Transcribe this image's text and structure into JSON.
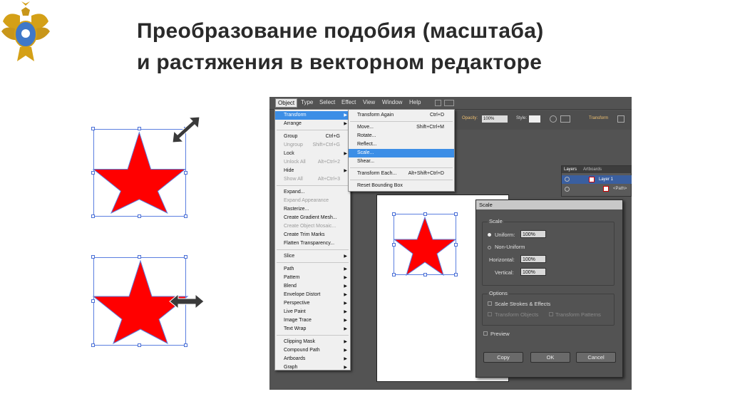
{
  "title_lines": [
    "Преобразование подобия (масштаба)",
    "и растяжения в векторном редакторе"
  ],
  "colors": {
    "star": "#ff0000",
    "selection": "#5b7fe0",
    "highlight": "#3c8ee6",
    "panel": "#535353"
  },
  "icons": [
    "emblem-icon",
    "diagonal-resize-arrow-icon",
    "horizontal-resize-arrow-icon",
    "star-shape-icon"
  ],
  "menubar": [
    "Object",
    "Type",
    "Select",
    "Effect",
    "View",
    "Window",
    "Help"
  ],
  "ctrlbar": {
    "opacity_label": "Opacity:",
    "opacity_value": "100%",
    "style_label": "Style:",
    "transform_label": "Transform"
  },
  "object_menu": [
    {
      "label": "Transform",
      "submenu": true,
      "highlighted": true
    },
    {
      "label": "Arrange",
      "submenu": true
    },
    {
      "sep": true
    },
    {
      "label": "Group",
      "shortcut": "Ctrl+G"
    },
    {
      "label": "Ungroup",
      "shortcut": "Shift+Ctrl+G",
      "disabled": true
    },
    {
      "label": "Lock",
      "submenu": true
    },
    {
      "label": "Unlock All",
      "shortcut": "Alt+Ctrl+2",
      "disabled": true
    },
    {
      "label": "Hide",
      "submenu": true
    },
    {
      "label": "Show All",
      "shortcut": "Alt+Ctrl+3",
      "disabled": true
    },
    {
      "sep": true
    },
    {
      "label": "Expand..."
    },
    {
      "label": "Expand Appearance",
      "disabled": true
    },
    {
      "label": "Rasterize..."
    },
    {
      "label": "Create Gradient Mesh..."
    },
    {
      "label": "Create Object Mosaic...",
      "disabled": true
    },
    {
      "label": "Create Trim Marks"
    },
    {
      "label": "Flatten Transparency..."
    },
    {
      "sep": true
    },
    {
      "label": "Slice",
      "submenu": true
    },
    {
      "sep": true
    },
    {
      "label": "Path",
      "submenu": true
    },
    {
      "label": "Pattern",
      "submenu": true
    },
    {
      "label": "Blend",
      "submenu": true
    },
    {
      "label": "Envelope Distort",
      "submenu": true
    },
    {
      "label": "Perspective",
      "submenu": true
    },
    {
      "label": "Live Paint",
      "submenu": true
    },
    {
      "label": "Image Trace",
      "submenu": true
    },
    {
      "label": "Text Wrap",
      "submenu": true
    },
    {
      "sep": true
    },
    {
      "label": "Clipping Mask",
      "submenu": true
    },
    {
      "label": "Compound Path",
      "submenu": true
    },
    {
      "label": "Artboards",
      "submenu": true
    },
    {
      "label": "Graph",
      "submenu": true
    }
  ],
  "transform_menu": [
    {
      "label": "Transform Again",
      "shortcut": "Ctrl+D"
    },
    {
      "sep": true
    },
    {
      "label": "Move...",
      "shortcut": "Shift+Ctrl+M"
    },
    {
      "label": "Rotate..."
    },
    {
      "label": "Reflect..."
    },
    {
      "label": "Scale...",
      "highlighted": true
    },
    {
      "label": "Shear..."
    },
    {
      "sep": true
    },
    {
      "label": "Transform Each...",
      "shortcut": "Alt+Shift+Ctrl+D"
    },
    {
      "sep": true
    },
    {
      "label": "Reset Bounding Box"
    }
  ],
  "layers_panel": {
    "tabs": [
      "Layers",
      "Artboards"
    ],
    "layer_name": "Layer 1",
    "path_name": "<Path>"
  },
  "scale_dialog": {
    "title": "Scale",
    "scale_group": "Scale",
    "uniform_label": "Uniform:",
    "uniform_value": "100%",
    "non_uniform_label": "Non-Uniform",
    "horizontal_label": "Horizontal:",
    "horizontal_value": "100%",
    "vertical_label": "Vertical:",
    "vertical_value": "100%",
    "options_group": "Options",
    "scale_strokes_label": "Scale Strokes & Effects",
    "transform_objects_label": "Transform Objects",
    "transform_patterns_label": "Transform Patterns",
    "preview_label": "Preview",
    "copy_label": "Copy",
    "ok_label": "OK",
    "cancel_label": "Cancel"
  }
}
